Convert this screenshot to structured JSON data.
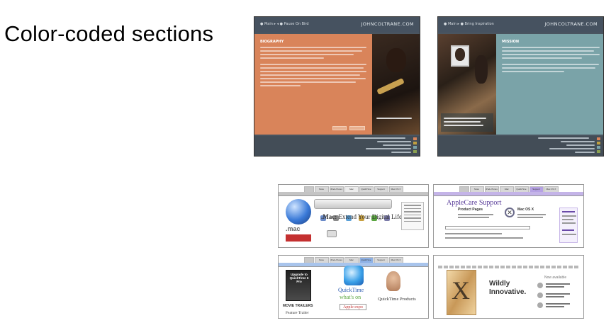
{
  "slide": {
    "title": "Color-coded sections"
  },
  "coltrane": [
    {
      "logo": "JOHNCOLTRANE.COM",
      "section_color": "#d9845a",
      "heading": "BIOGRAPHY",
      "nav": "● Main ▸ ◂ ● Pause On Bird"
    },
    {
      "logo": "JOHNCOLTRANE.COM",
      "section_color": "#7aa3a8",
      "heading": "MISSION",
      "nav": "● Main ▸ ● Bring Inspiration"
    }
  ],
  "apple": {
    "tabs": [
      "Store",
      "iPod+iTunes",
      ".Mac",
      "QuickTime",
      "Support",
      "Mac OS X"
    ],
    "mac": {
      "logo_text": ".mac",
      "tagline_prefix": ".Mac:",
      "tagline": "Extend Your Digital Life"
    },
    "applecare": {
      "title": "AppleCare Support",
      "product_pages": "Product Pages",
      "osx_label": "Mac OS X",
      "accent": "#5a3e9a"
    },
    "quicktime": {
      "box_text": "Upgrade to QuickTime 6 Pro",
      "logo_label": "QuickTime",
      "whats_on": "what's on",
      "expo": "Apple expo",
      "trailers": "MOVIE TRAILERS",
      "feature": "Feature Trailer",
      "products": "QuickTime Products",
      "accent": "#2a5ab0"
    },
    "osx": {
      "glyph": "X",
      "headline_1": "Wildly",
      "headline_2": "Innovative.",
      "available": "Now available"
    }
  }
}
